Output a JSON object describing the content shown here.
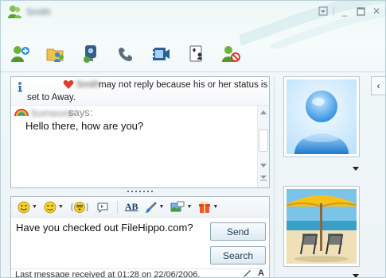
{
  "window": {
    "title": "Smith",
    "controls": {
      "menu": "▾",
      "minimize": "_",
      "maximize": "☐",
      "close": "✕"
    }
  },
  "toolbar": {
    "items": [
      {
        "name": "invite-contact",
        "icon": "add-contact-icon"
      },
      {
        "name": "send-files",
        "icon": "folder-share-icon"
      },
      {
        "name": "video-call",
        "icon": "webcam-icon"
      },
      {
        "name": "voice-call",
        "icon": "phone-icon"
      },
      {
        "name": "activities",
        "icon": "film-icon"
      },
      {
        "name": "games",
        "icon": "games-icon"
      },
      {
        "name": "block",
        "icon": "block-contact-icon"
      }
    ]
  },
  "conversation": {
    "notice": {
      "contact_name": "Smith",
      "line1": "may not reply because his or her status is",
      "line2": "set to Away."
    },
    "messages": [
      {
        "sender": "Someone",
        "says": "says:",
        "text": "Hello there, how are you?"
      }
    ]
  },
  "input": {
    "text": "Have you checked out FileHippo.com?",
    "send_label": "Send",
    "search_label": "Search",
    "status": "Last message received at 01:28 on 22/06/2006.",
    "font_button": "A"
  },
  "format_bar": {
    "font_button": "AB"
  },
  "colors": {
    "accent": "#3a78b5",
    "border": "#a9bcc6",
    "heart": "#e03b2e"
  },
  "side": {
    "collapse": "‹"
  }
}
